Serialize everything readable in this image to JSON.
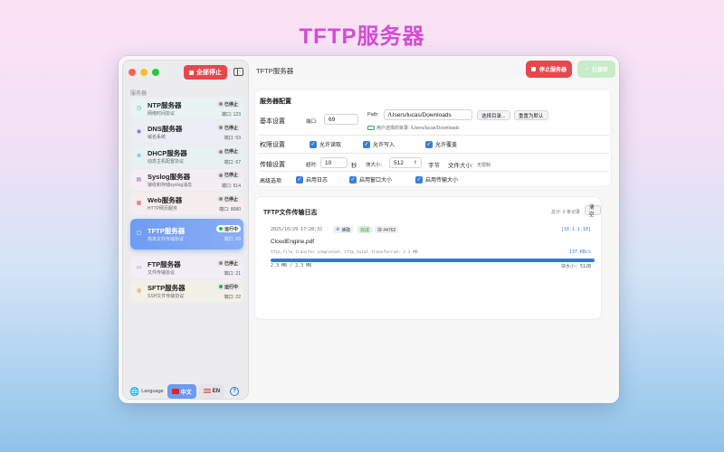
{
  "page_heading": "TFTP服务器",
  "sidebar": {
    "stop_all_label": "全部停止",
    "section_label": "服务器",
    "servers": [
      {
        "name": "NTP服务器",
        "desc": "网络时间协议",
        "status": "已停止",
        "port": "端口: 123",
        "icon": "clock-icon",
        "color": "#2aa7c9",
        "bg": "#e9f3f3"
      },
      {
        "name": "DNS服务器",
        "desc": "域名系统",
        "status": "已停止",
        "port": "端口: 53",
        "icon": "globe-icon",
        "color": "#5a6fd6",
        "bg": "#eceef6"
      },
      {
        "name": "DHCP服务器",
        "desc": "动态主机配置协议",
        "status": "已停止",
        "port": "端口: 67",
        "icon": "network-icon",
        "color": "#3aa0c0",
        "bg": "#e8f1f1"
      },
      {
        "name": "Syslog服务器",
        "desc": "接收和存储syslog消息",
        "status": "已停止",
        "port": "端口: 514",
        "icon": "document-icon",
        "color": "#8a62d0",
        "bg": "#f4eef4"
      },
      {
        "name": "Web服务器",
        "desc": "HTTP网页服务",
        "status": "已停止",
        "port": "端口: 8080",
        "icon": "server-icon",
        "color": "#e05a5a",
        "bg": "#f6eeee"
      },
      {
        "name": "TFTP服务器",
        "desc": "简单文件传输协议",
        "status": "运行中",
        "port": "端口: 69",
        "icon": "file-icon",
        "color": "#ffffff",
        "bg": "",
        "active": true
      },
      {
        "name": "FTP服务器",
        "desc": "文件传输协议",
        "status": "已停止",
        "port": "端口: 21",
        "icon": "folder-icon",
        "color": "#8a62d0",
        "bg": "#f3eef6"
      },
      {
        "name": "SFTP服务器",
        "desc": "SSH文件传输协议",
        "status": "运行中",
        "port": "端口: 22",
        "icon": "lock-icon",
        "color": "#e08a2a",
        "bg": "#f3f0e8"
      }
    ],
    "language_label": "Language",
    "lang_cn": "中文",
    "lang_en": "EN",
    "help": "?"
  },
  "header": {
    "title": "TFTP服务器",
    "stop_label": "停止服务器",
    "save_label": "已保存"
  },
  "config": {
    "title": "服务器配置",
    "basic": {
      "label": "基本设置",
      "port_label": "端口:",
      "port_value": "69",
      "path_label": "Path:",
      "path_value": "/Users/lucas/Downloads",
      "select_dir": "选择目录...",
      "reset": "重置为默认",
      "user_dir_hint": "用户选择的目录: /Users/lucas/Downloads"
    },
    "permissions": {
      "label": "权限设置",
      "read": "允许读取",
      "write": "允许写入",
      "overwrite": "允许覆盖"
    },
    "transfer": {
      "label": "传输设置",
      "timeout_label": "超时:",
      "timeout_value": "10",
      "timeout_unit": "秒",
      "block_label": "块大小:",
      "block_value": "512",
      "block_unit": "字节",
      "file_size_label": "文件大小:",
      "file_size_value": "无限制"
    },
    "advanced": {
      "label": "高级选项",
      "log": "启用日志",
      "window": "启用窗口大小",
      "tsize": "启用传输大小"
    }
  },
  "log": {
    "title": "TFTP文件传输日志",
    "count": "总计: 0 条记录",
    "clear": "清空",
    "entry": {
      "time": "2025/10/29 17:28:32",
      "op": "读取",
      "result": "完成",
      "block": "块 #4762",
      "ip": "[10.1.1.10]",
      "filename": "CloudEngine.pdf",
      "detail": "tftp_file_transfer_completed; tftp_total_transferred: 2.3 MB",
      "speed": "137 KB/s",
      "progress_fraction": 1.0,
      "progress_text": "2.3 MB / 2.3 MB",
      "block_size": "块大小: 512B"
    }
  }
}
